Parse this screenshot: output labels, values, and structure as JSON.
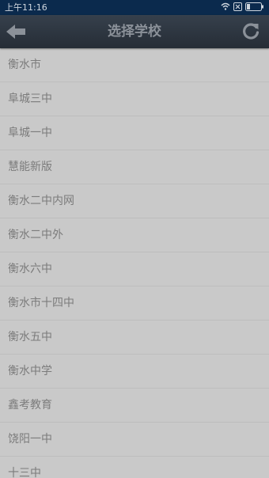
{
  "status_bar": {
    "time": "上午11:16",
    "icons": [
      "wifi-icon",
      "sim-card-icon",
      "battery-icon"
    ]
  },
  "header": {
    "title": "选择学校",
    "back_icon": "back-arrow-icon",
    "refresh_icon": "refresh-icon"
  },
  "schools": [
    "衡水市",
    "阜城三中",
    "阜城一中",
    "慧能新版",
    "衡水二中内网",
    "衡水二中外",
    "衡水六中",
    "衡水市十四中",
    "衡水五中",
    "衡水中学",
    "鑫考教育",
    "饶阳一中",
    "十三中"
  ],
  "colors": {
    "status_bar_bg": "#0b2a4d",
    "header_bg": "#2e3640",
    "list_bg": "#c9c9c9",
    "item_text": "#7c7c7c"
  }
}
